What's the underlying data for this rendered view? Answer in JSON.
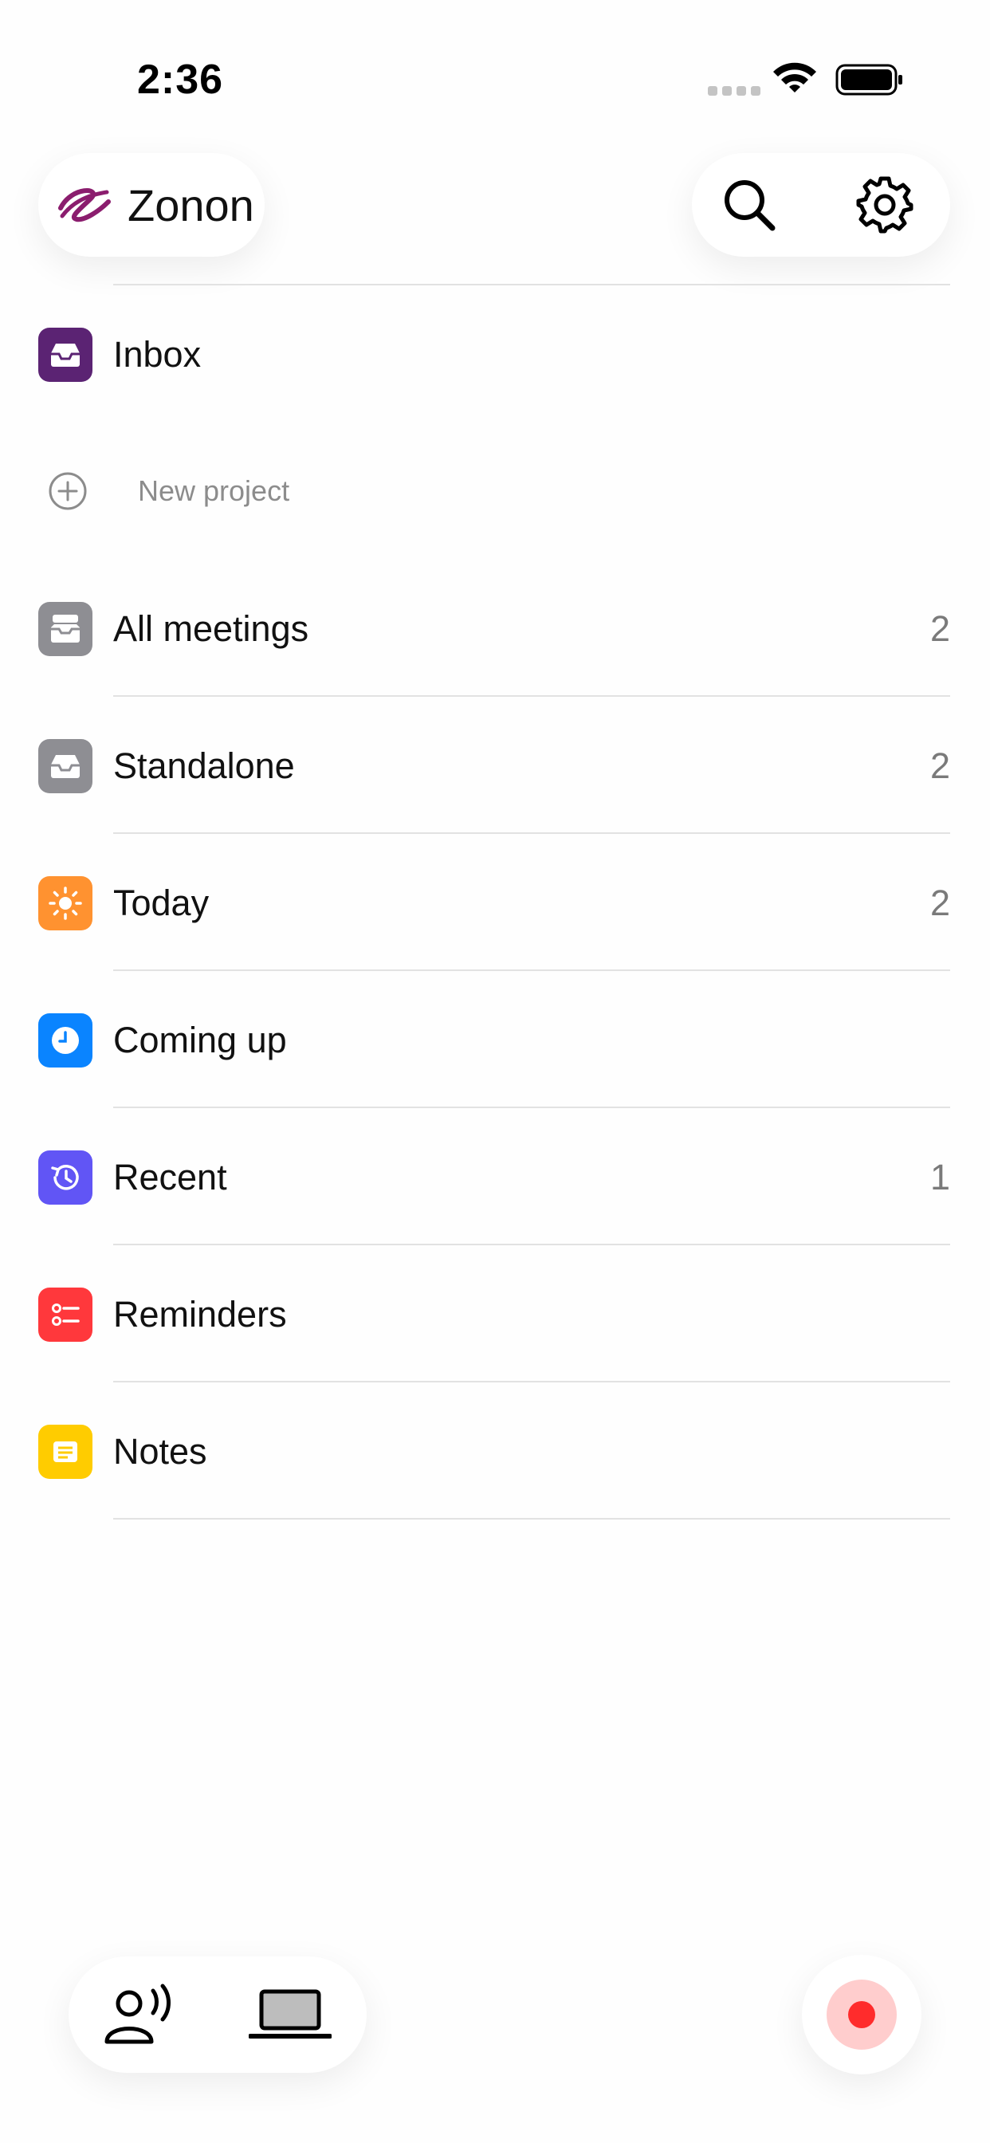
{
  "status_bar": {
    "time": "2:36"
  },
  "header": {
    "app_name": "Zonon"
  },
  "inbox": {
    "label": "Inbox",
    "icon": "tray-icon",
    "color": "#5b2373"
  },
  "new_project": {
    "label": "New project"
  },
  "lists": [
    {
      "label": "All meetings",
      "count": "2",
      "icon": "archive-tray-icon",
      "color": "#8e8e93"
    },
    {
      "label": "Standalone",
      "count": "2",
      "icon": "tray-icon",
      "color": "#8e8e93"
    },
    {
      "label": "Today",
      "count": "2",
      "icon": "sun-icon",
      "color": "#ff9230"
    },
    {
      "label": "Coming up",
      "count": "",
      "icon": "clock-icon",
      "color": "#0a84ff"
    },
    {
      "label": "Recent",
      "count": "1",
      "icon": "history-icon",
      "color": "#6155f5"
    },
    {
      "label": "Reminders",
      "count": "",
      "icon": "checklist-icon",
      "color": "#ff383c"
    },
    {
      "label": "Notes",
      "count": "",
      "icon": "note-icon",
      "color": "#ffcc00"
    }
  ],
  "bottom_bar": {
    "left_icons": [
      "voice-person-icon",
      "laptop-icon"
    ],
    "record_color": "#ff2c2c"
  }
}
